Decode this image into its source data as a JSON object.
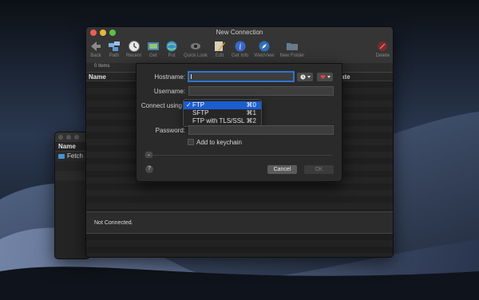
{
  "window": {
    "title": "New Connection"
  },
  "toolbar": {
    "buttons": [
      {
        "label": "Back",
        "icon": "arrow-left-icon"
      },
      {
        "label": "Path",
        "icon": "folders-icon"
      },
      {
        "label": "Recent",
        "icon": "clock-icon"
      },
      {
        "label": "Get",
        "icon": "download-icon"
      },
      {
        "label": "Put",
        "icon": "globe-upload-icon"
      },
      {
        "label": "Quick Look",
        "icon": "eye-icon"
      },
      {
        "label": "Edit",
        "icon": "pencil-icon"
      },
      {
        "label": "Get Info",
        "icon": "info-icon"
      },
      {
        "label": "WebView",
        "icon": "compass-icon"
      },
      {
        "label": "New Folder",
        "icon": "folder-plus-icon"
      }
    ],
    "delete_label": "Delete"
  },
  "list": {
    "items_count": "0 Items",
    "col_name": "Name",
    "col_date": "ate"
  },
  "status": {
    "text": "Not Connected."
  },
  "back_window": {
    "header": "Name",
    "item": "Fetch S"
  },
  "dialog": {
    "hostname_label": "Hostname:",
    "username_label": "Username:",
    "connect_using_label": "Connect using",
    "password_label": "Password:",
    "keychain_label": "Add to keychain",
    "cancel_label": "Cancel",
    "ok_label": "OK",
    "help_label": "?"
  },
  "protocol_menu": {
    "selected": "FTP",
    "items": [
      {
        "label": "FTP",
        "check": "✓",
        "shortcut": "⌘0"
      },
      {
        "label": "SFTP",
        "check": "",
        "shortcut": "⌘1"
      },
      {
        "label": "FTP with TLS/SSL",
        "check": "",
        "shortcut": "⌘2"
      }
    ]
  },
  "colors": {
    "accent": "#1c5dd0",
    "focus_ring": "#2f74d0",
    "close": "#ee5d56",
    "minimize": "#e6b83a",
    "zoom": "#5bc245"
  }
}
